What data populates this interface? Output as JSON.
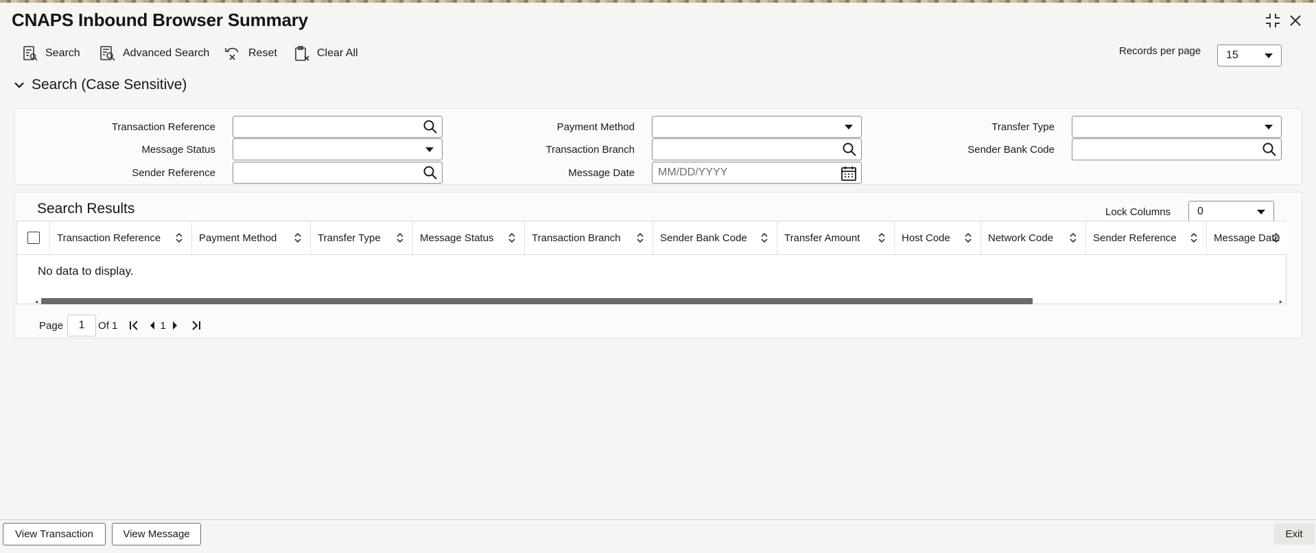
{
  "window": {
    "title": "CNAPS Inbound Browser Summary"
  },
  "toolbar": {
    "search_label": "Search",
    "advanced_search_label": "Advanced Search",
    "reset_label": "Reset",
    "clear_all_label": "Clear All",
    "records_per_page_label": "Records per page",
    "records_per_page_value": "15"
  },
  "search_section": {
    "title": "Search (Case Sensitive)",
    "fields": {
      "transaction_reference": {
        "label": "Transaction Reference",
        "value": ""
      },
      "payment_method": {
        "label": "Payment Method",
        "value": ""
      },
      "transfer_type": {
        "label": "Transfer Type",
        "value": ""
      },
      "message_status": {
        "label": "Message Status",
        "value": ""
      },
      "transaction_branch": {
        "label": "Transaction Branch",
        "value": ""
      },
      "sender_bank_code": {
        "label": "Sender Bank Code",
        "value": ""
      },
      "sender_reference": {
        "label": "Sender Reference",
        "value": ""
      },
      "message_date": {
        "label": "Message Date",
        "value": "",
        "placeholder": "MM/DD/YYYY"
      }
    }
  },
  "results": {
    "title": "Search Results",
    "lock_columns_label": "Lock Columns",
    "lock_columns_value": "0",
    "columns": [
      "Transaction Reference",
      "Payment Method",
      "Transfer Type",
      "Message Status",
      "Transaction Branch",
      "Sender Bank Code",
      "Transfer Amount",
      "Host Code",
      "Network Code",
      "Sender Reference",
      "Message Date"
    ],
    "empty_message": "No data to display.",
    "pagination": {
      "page_label": "Page",
      "current_page": "1",
      "of_label": "Of 1",
      "page_number": "1"
    }
  },
  "footer": {
    "view_transaction_label": "View Transaction",
    "view_message_label": "View Message",
    "exit_label": "Exit"
  },
  "colors": {
    "background": "#f6f5f3",
    "border": "#8c8b89",
    "text": "#1a1a1a"
  }
}
